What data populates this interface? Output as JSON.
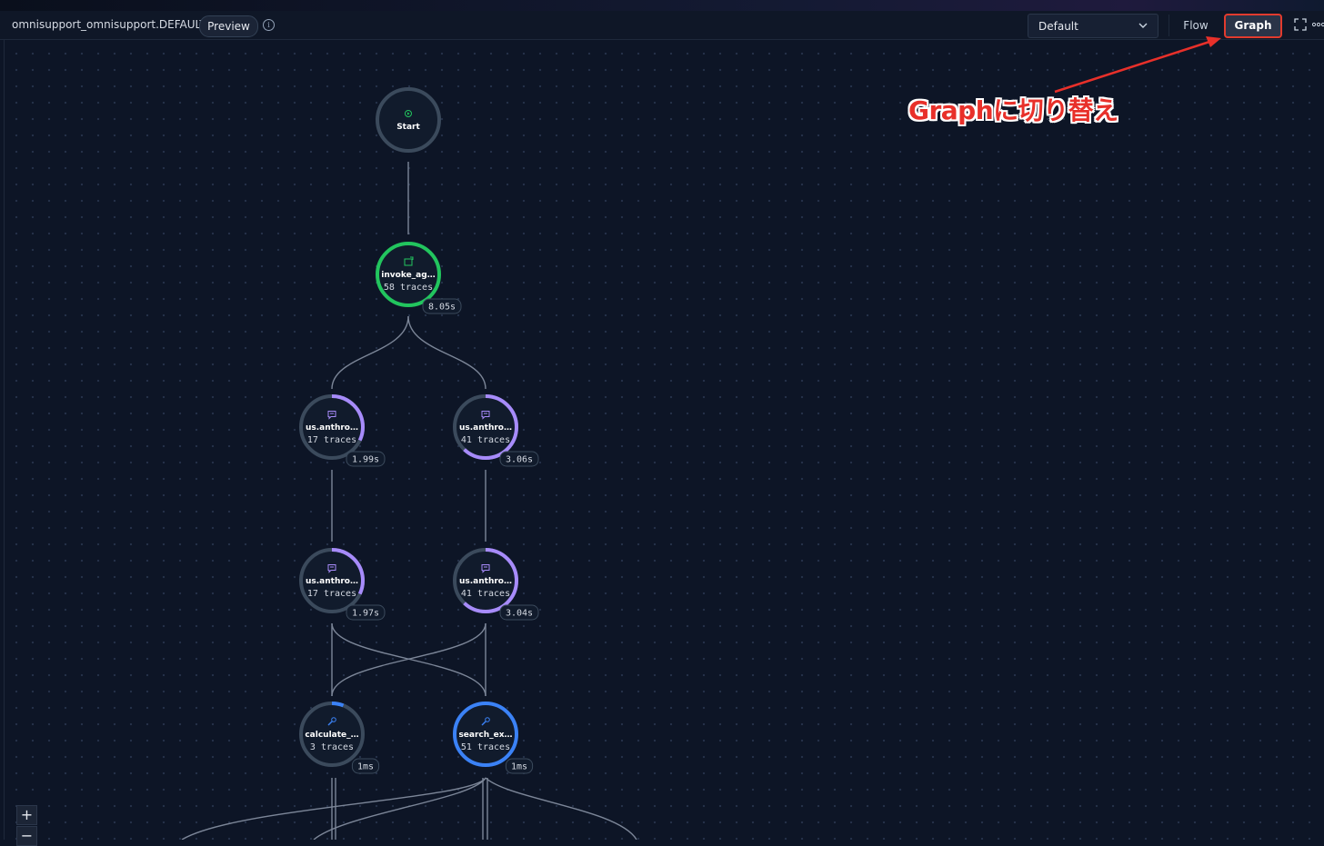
{
  "toolbar": {
    "title": "omnisupport_omnisupport.DEFAULT",
    "preview_label": "Preview",
    "info_icon": "info-icon",
    "select_value": "Default",
    "tab_flow": "Flow",
    "tab_graph": "Graph",
    "expand_icon": "expand-icon",
    "more_icon": "more-icon"
  },
  "annotation": {
    "text": "Graphに切り替え",
    "color": "#e8302a"
  },
  "graph": {
    "nodes": [
      {
        "id": "start",
        "label": "Start",
        "traces": "",
        "time": "",
        "icon": "play-icon",
        "ring": "#3b4a5c",
        "accent": null,
        "progress": 0
      },
      {
        "id": "invoke",
        "label": "invoke_ag…",
        "traces": "58 traces",
        "time": "8.05s",
        "icon": "agent-icon",
        "ring": "#22c55e",
        "accent": "#22c55e",
        "progress": 1
      },
      {
        "id": "llm1",
        "label": "us.anthro…",
        "traces": "17 traces",
        "time": "1.99s",
        "icon": "chat-icon",
        "ring": "#3b4a5c",
        "accent": "#a78bfa",
        "progress": 0.32
      },
      {
        "id": "llm2",
        "label": "us.anthro…",
        "traces": "41 traces",
        "time": "3.06s",
        "icon": "chat-icon",
        "ring": "#3b4a5c",
        "accent": "#a78bfa",
        "progress": 0.62
      },
      {
        "id": "llm3",
        "label": "us.anthro…",
        "traces": "17 traces",
        "time": "1.97s",
        "icon": "chat-icon",
        "ring": "#3b4a5c",
        "accent": "#a78bfa",
        "progress": 0.32
      },
      {
        "id": "llm4",
        "label": "us.anthro…",
        "traces": "41 traces",
        "time": "3.04s",
        "icon": "chat-icon",
        "ring": "#3b4a5c",
        "accent": "#a78bfa",
        "progress": 0.62
      },
      {
        "id": "tool1",
        "label": "calculate_…",
        "traces": "3 traces",
        "time": "1ms",
        "icon": "wrench-icon",
        "ring": "#3b4a5c",
        "accent": "#3b82f6",
        "progress": 0.06
      },
      {
        "id": "tool2",
        "label": "search_ex…",
        "traces": "51 traces",
        "time": "1ms",
        "icon": "wrench-icon",
        "ring": "#3b82f6",
        "accent": "#3b82f6",
        "progress": 1
      }
    ]
  },
  "zoom": {
    "in_label": "+",
    "out_label": "−"
  }
}
